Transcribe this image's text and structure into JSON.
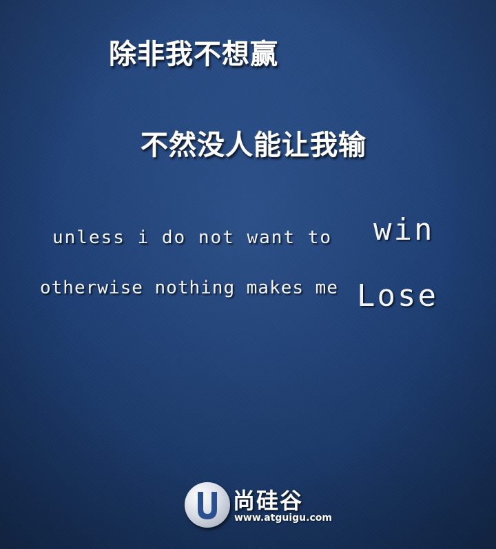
{
  "headline": {
    "line1": "除非我不想赢",
    "line2": "不然没人能让我输"
  },
  "english": {
    "line1_text": "unless i do not want to",
    "line1_emphasis": "win",
    "line2_text": "otherwise nothing makes me",
    "line2_emphasis": "Lose"
  },
  "logo": {
    "icon": "u-circle-logo-icon",
    "name": "尚硅谷",
    "url": "www.atguigu.com"
  },
  "colors": {
    "background": "#1d3f75",
    "text": "#ffffff"
  }
}
